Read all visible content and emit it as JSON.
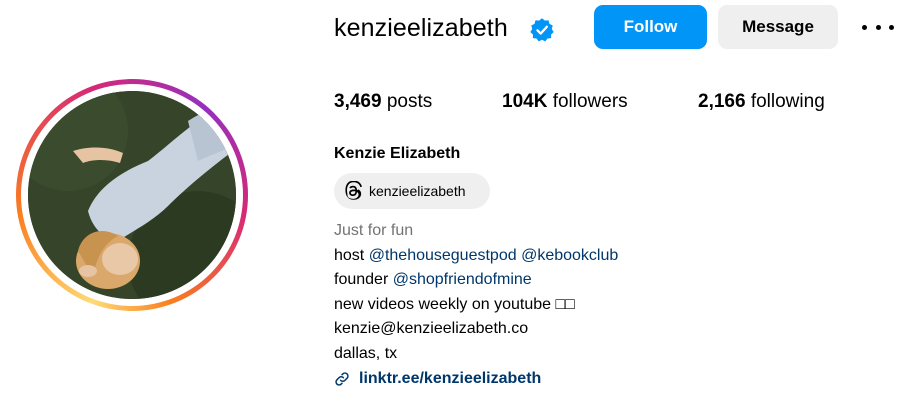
{
  "profile": {
    "username": "kenzieelizabeth",
    "verified": true,
    "follow_label": "Follow",
    "message_label": "Message",
    "full_name": "Kenzie Elizabeth"
  },
  "stats": {
    "posts_count": "3,469",
    "posts_label": "posts",
    "followers_count": "104K",
    "followers_label": "followers",
    "following_count": "2,166",
    "following_label": "following"
  },
  "threads": {
    "handle": "kenzieelizabeth"
  },
  "bio": {
    "category": "Just for fun",
    "host_prefix": "host",
    "host_mention_1": "@thehouseguestpod",
    "host_mention_2": "@kebookclub",
    "founder_prefix": "founder",
    "founder_mention": "@shopfriendofmine",
    "line_videos": "new videos weekly on youtube □□",
    "line_email": "kenzie@kenzieelizabeth.co",
    "line_location": "dallas, tx",
    "link": "linktr.ee/kenzieelizabeth"
  },
  "colors": {
    "accent": "#0095f6",
    "link": "#00376b",
    "muted": "#737373",
    "button_secondary": "#efefef",
    "verified": "#0095f6"
  },
  "icons": {
    "verified": "verified-badge-icon",
    "more": "more-options-icon",
    "threads": "threads-icon",
    "link": "link-icon"
  }
}
